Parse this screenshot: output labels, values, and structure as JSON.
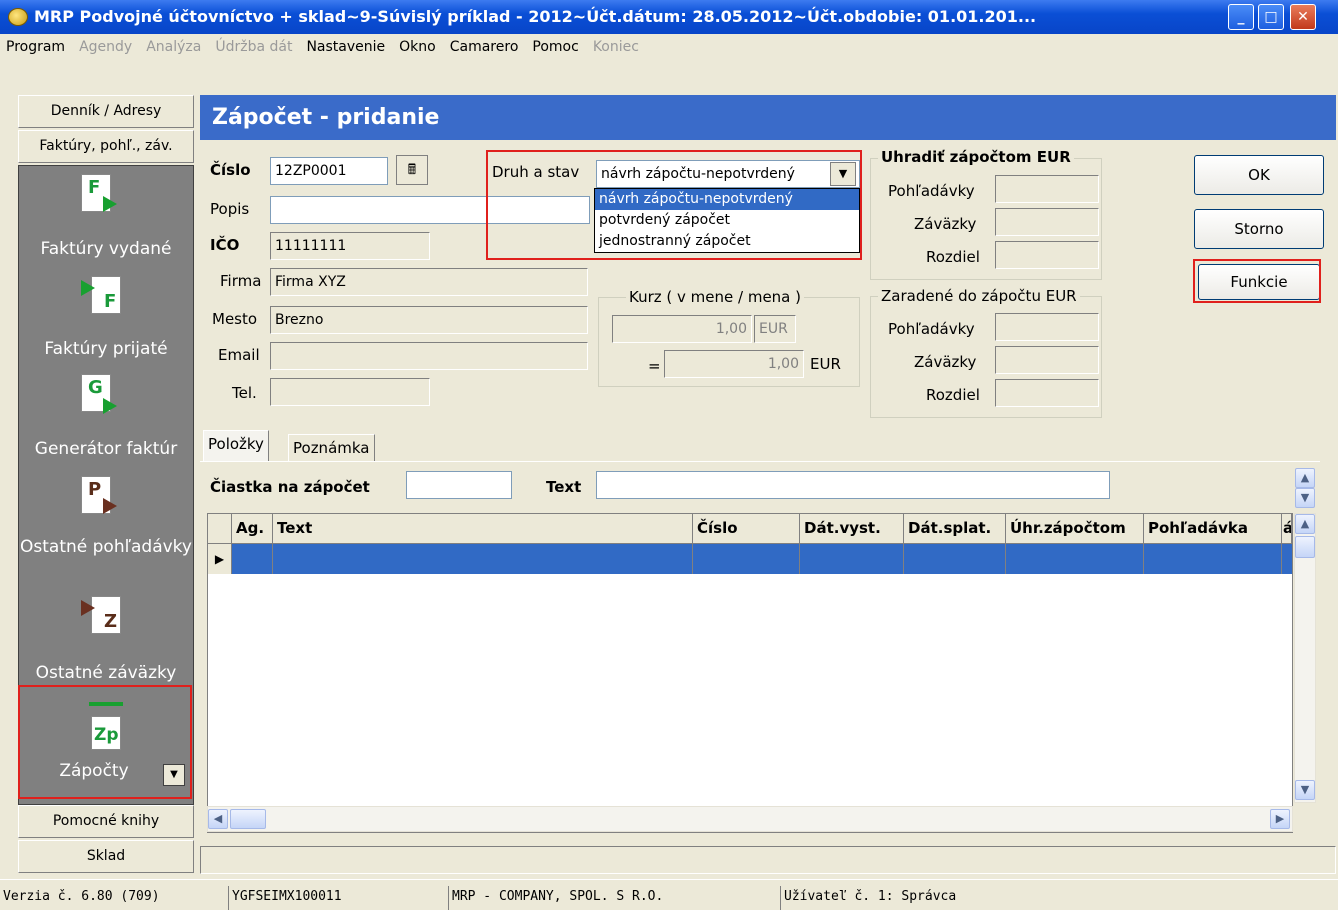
{
  "window": {
    "title": "MRP Podvojné účtovníctvo + sklad~9-Súvislý príklad - 2012~Účt.dátum: 28.05.2012~Účt.obdobie: 01.01.201..."
  },
  "menu": [
    {
      "label": "Program",
      "enabled": true
    },
    {
      "label": "Agendy",
      "enabled": false
    },
    {
      "label": "Analýza",
      "enabled": false
    },
    {
      "label": "Údržba dát",
      "enabled": false
    },
    {
      "label": "Nastavenie",
      "enabled": true
    },
    {
      "label": "Okno",
      "enabled": true
    },
    {
      "label": "Camarero",
      "enabled": true
    },
    {
      "label": "Pomoc",
      "enabled": true
    },
    {
      "label": "Koniec",
      "enabled": false
    }
  ],
  "sidebar": {
    "denník": "Denník / Adresy",
    "faktury": "Faktúry, pohľ., záv.",
    "items": [
      {
        "label": "Faktúry vydané",
        "icon": "F"
      },
      {
        "label": "Faktúry prijaté",
        "icon": "F"
      },
      {
        "label": "Generátor faktúr",
        "icon": "G"
      },
      {
        "label": "Ostatné pohľadávky",
        "icon": "P"
      },
      {
        "label": "Ostatné záväzky",
        "icon": "Z"
      },
      {
        "label": "Zápočty",
        "icon": "Zp"
      }
    ],
    "pomocne": "Pomocné knihy",
    "sklad": "Sklad"
  },
  "form": {
    "header": "Zápočet - pridanie",
    "cislo_label": "Číslo",
    "cislo": "12ZP0001",
    "popis_label": "Popis",
    "popis": "",
    "ico_label": "IČO",
    "ico": "11111111",
    "firma_label": "Firma",
    "firma": "Firma XYZ",
    "mesto_label": "Mesto",
    "mesto": "Brezno",
    "email_label": "Email",
    "email": "",
    "tel_label": "Tel.",
    "tel": "",
    "druh_label": "Druh a stav",
    "druh_value": "návrh zápočtu-nepotvrdený",
    "druh_options": [
      "návrh zápočtu-nepotvrdený",
      "potvrdený zápočet",
      "jednostranný zápočet"
    ],
    "kurz_title": "Kurz ( v mene / mena )",
    "kurz_value": "1,00",
    "kurz_curr": "EUR",
    "kurz_eq": "=",
    "kurz_value2": "1,00",
    "kurz_curr2": "EUR",
    "uhradit_title": "Uhradiť zápočtom EUR",
    "zaradene_title": "Zaradené do zápočtu EUR",
    "pohladavky": "Pohľadávky",
    "zavazky": "Záväzky",
    "rozdiel": "Rozdiel",
    "ok": "OK",
    "storno": "Storno",
    "funkcie": "Funkcie",
    "tab_polozky": "Položky",
    "tab_poznamka": "Poznámka",
    "ciastka_label": "Čiastka na zápočet",
    "text_label": "Text"
  },
  "grid": {
    "columns": [
      "Ag.",
      "Text",
      "Číslo",
      "Dát.vyst.",
      "Dát.splat.",
      "Úhr.zápočtom",
      "Pohľadávka",
      "á"
    ]
  },
  "status": {
    "version": "Verzia č. 6.80 (709)",
    "code": "YGFSEIMX100011",
    "company": "MRP - COMPANY, SPOL. S R.O.",
    "user": "Užívateľ č. 1: Správca"
  }
}
